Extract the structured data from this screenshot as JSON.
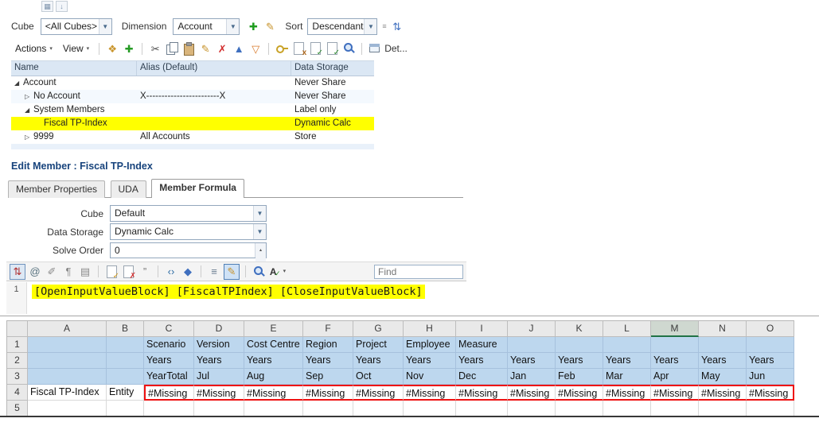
{
  "colors": {
    "blue_fill": "#bdd7ee",
    "highlight_yellow": "#ffff00",
    "missing_border_red": "#ff0000",
    "selected_column_green": "#217346",
    "heading_navy": "#17437c"
  },
  "outline": {
    "toolbar": {
      "cube_label": "Cube",
      "cube_value": "<All Cubes>",
      "dimension_label": "Dimension",
      "dimension_value": "Account",
      "sort_label": "Sort",
      "sort_value": "Descendants"
    },
    "toolbar1_icons": [
      {
        "type": "glyph",
        "name": "add-member-icon",
        "glyph": "✚",
        "color": "#1e9c1e"
      },
      {
        "type": "glyph",
        "name": "edit-member-icon",
        "glyph": "✎",
        "color": "#c69026"
      }
    ],
    "toolbar1_sort_icons": [
      {
        "type": "glyph",
        "name": "sort-order-icon",
        "glyph": "⇅",
        "color": "#3f6fbf"
      }
    ],
    "actions_label": "Actions",
    "view_label": "View",
    "detach_label": "Det...",
    "toolbar2_icons": [
      {
        "type": "glyph",
        "name": "promote-member-icon",
        "glyph": "❖",
        "color": "#c9952c"
      },
      {
        "type": "glyph",
        "name": "add-child-icon",
        "glyph": "✚",
        "color": "#259b24"
      },
      {
        "type": "sep"
      },
      {
        "type": "glyph",
        "name": "cut-icon",
        "glyph": "✂",
        "color": "#4a4a4a"
      },
      {
        "type": "copy",
        "name": "copy-icon"
      },
      {
        "type": "paste",
        "name": "paste-icon"
      },
      {
        "type": "glyph",
        "name": "edit-icon",
        "glyph": "✎",
        "color": "#c69026"
      },
      {
        "type": "glyph",
        "name": "delete-icon",
        "glyph": "✗",
        "color": "#d22d2d"
      },
      {
        "type": "glyph",
        "name": "move-up-icon",
        "glyph": "▲",
        "color": "#3f6fbf"
      },
      {
        "type": "glyph",
        "name": "move-down-icon",
        "glyph": "▽",
        "color": "#d97b2d"
      },
      {
        "type": "sep"
      },
      {
        "type": "key",
        "name": "keys-icon"
      },
      {
        "type": "doc",
        "name": "xml-icon",
        "overlay": "x",
        "ocolor": "#b06a1f"
      },
      {
        "type": "doc",
        "name": "validate-icon",
        "overlay": "✓",
        "ocolor": "#2e8b2e"
      },
      {
        "type": "doc",
        "name": "verify-icon",
        "overlay": "✓",
        "ocolor": "#2e8b2e"
      },
      {
        "type": "magnifier",
        "name": "search-icon"
      },
      {
        "type": "sep"
      }
    ],
    "tree": {
      "columns": [
        "Name",
        "Alias (Default)",
        "Data Storage"
      ],
      "rows": [
        {
          "name": "Account",
          "alias": "",
          "storage": "Never Share",
          "level": 0,
          "glyph": "◢",
          "highlight": false
        },
        {
          "name": "No Account",
          "alias": "X------------------------X",
          "storage": "Never Share",
          "level": 1,
          "glyph": "▷",
          "highlight": false
        },
        {
          "name": "System Members",
          "alias": "",
          "storage": "Label only",
          "level": 1,
          "glyph": "◢",
          "highlight": false
        },
        {
          "name": "Fiscal TP-Index",
          "alias": "",
          "storage": "Dynamic Calc",
          "level": 2,
          "glyph": "",
          "highlight": true
        },
        {
          "name": "9999",
          "alias": "All Accounts",
          "storage": "Store",
          "level": 1,
          "glyph": "▷",
          "highlight": false
        }
      ]
    }
  },
  "editor": {
    "title": "Edit Member : Fiscal TP-Index",
    "tabs": [
      {
        "label": "Member Properties",
        "active": false
      },
      {
        "label": "UDA",
        "active": false
      },
      {
        "label": "Member Formula",
        "active": true
      }
    ],
    "cube_label": "Cube",
    "cube_value": "Default",
    "storage_label": "Data Storage",
    "storage_value": "Dynamic Calc",
    "solve_label": "Solve Order",
    "solve_value": "0",
    "find_placeholder": "Find",
    "formula_line_number": "1",
    "formula_text": "[OpenInputValueBlock] [FiscalTPIndex] [CloseInputValueBlock]",
    "toolbar_icons": [
      {
        "type": "boxed",
        "name": "line-number-toggle-icon",
        "glyph": "⇅",
        "color": "#b03030"
      },
      {
        "type": "glyph",
        "name": "insert-member-icon",
        "glyph": "@",
        "color": "#55707d"
      },
      {
        "type": "glyph",
        "name": "insert-variable-icon",
        "glyph": "✐",
        "color": "#8a8a8a"
      },
      {
        "type": "glyph",
        "name": "paragraph-icon",
        "glyph": "¶",
        "color": "#8a8a8a"
      },
      {
        "type": "glyph",
        "name": "template-icon",
        "glyph": "▤",
        "color": "#8a8a8a"
      },
      {
        "type": "sep"
      },
      {
        "type": "doc",
        "name": "check-syntax-icon",
        "overlay": "✓",
        "ocolor": "#cf9a1f"
      },
      {
        "type": "doc",
        "name": "clear-errors-icon",
        "overlay": "✗",
        "ocolor": "#d23333"
      },
      {
        "type": "glyph",
        "name": "comment-icon",
        "glyph": "”",
        "color": "#7a7a7a"
      },
      {
        "type": "sep"
      },
      {
        "type": "glyph",
        "name": "insert-code-icon",
        "glyph": "‹›",
        "color": "#2e6da4"
      },
      {
        "type": "glyph",
        "name": "verify-formula-icon",
        "glyph": "◆",
        "color": "#3f6fbf"
      },
      {
        "type": "sep"
      },
      {
        "type": "glyph",
        "name": "indent-icon",
        "glyph": "≡",
        "color": "#6a7d90"
      },
      {
        "type": "boxed-active",
        "name": "syntax-highlight-toggle-icon",
        "glyph": "✎",
        "color": "#c69026"
      },
      {
        "type": "sep"
      },
      {
        "type": "magnifier",
        "name": "find-next-icon"
      },
      {
        "type": "spell",
        "name": "spell-check-icon"
      }
    ]
  },
  "spreadsheet": {
    "columns": [
      "A",
      "B",
      "C",
      "D",
      "E",
      "F",
      "G",
      "H",
      "I",
      "J",
      "K",
      "L",
      "M",
      "N",
      "O"
    ],
    "selected_column": "M",
    "rows": [
      {
        "num": "1",
        "fill": "blue",
        "cells": [
          "",
          "",
          "Scenario",
          "Version",
          "Cost Centre",
          "Region",
          "Project",
          "Employee",
          "Measure",
          "",
          "",
          "",
          "",
          "",
          ""
        ]
      },
      {
        "num": "2",
        "fill": "blue",
        "cells": [
          "",
          "",
          "Years",
          "Years",
          "Years",
          "Years",
          "Years",
          "Years",
          "Years",
          "Years",
          "Years",
          "Years",
          "Years",
          "Years",
          "Years"
        ]
      },
      {
        "num": "3",
        "fill": "blue",
        "cells": [
          "",
          "",
          "YearTotal",
          "Jul",
          "Aug",
          "Sep",
          "Oct",
          "Nov",
          "Dec",
          "Jan",
          "Feb",
          "Mar",
          "Apr",
          "May",
          "Jun"
        ]
      },
      {
        "num": "4",
        "fill": "white",
        "cells": [
          "Fiscal TP-Index",
          "Entity",
          "#Missing",
          "#Missing",
          "#Missing",
          "#Missing",
          "#Missing",
          "#Missing",
          "#Missing",
          "#Missing",
          "#Missing",
          "#Missing",
          "#Missing",
          "#Missing",
          "#Missing"
        ]
      },
      {
        "num": "5",
        "fill": "white",
        "cells": [
          "",
          "",
          "",
          "",
          "",
          "",
          "",
          "",
          "",
          "",
          "",
          "",
          "",
          "",
          ""
        ]
      }
    ],
    "missing_range": {
      "row": "4",
      "from": "C",
      "to": "O"
    }
  }
}
